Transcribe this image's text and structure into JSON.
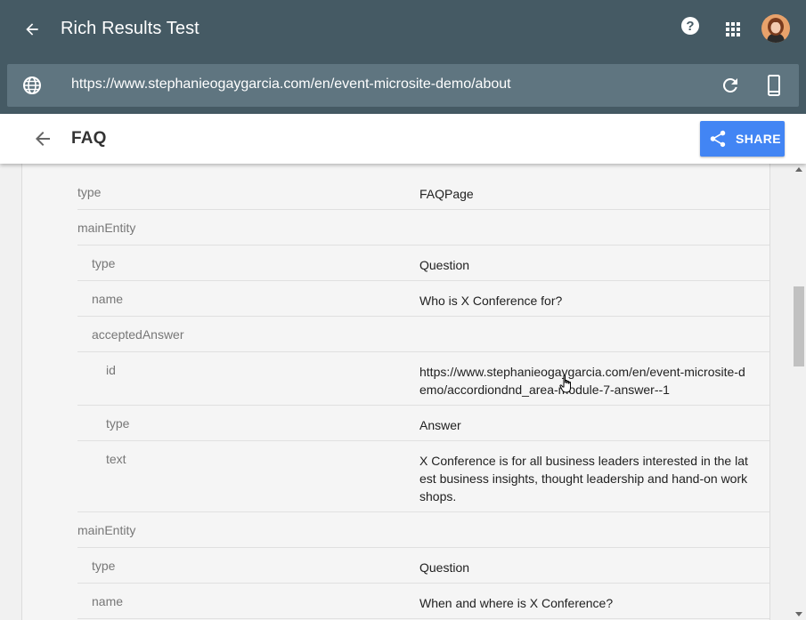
{
  "app": {
    "title": "Rich Results Test",
    "url": "https://www.stephanieogaygarcia.com/en/event-microsite-demo/about"
  },
  "subheader": {
    "title": "FAQ",
    "share_label": "SHARE"
  },
  "colors": {
    "appbar": "#455a64",
    "urlbar": "#5f7580",
    "share_button": "#4285f4"
  },
  "icons": {
    "back": "arrow-left-icon",
    "help": "help-icon",
    "apps": "apps-grid-icon",
    "globe": "globe-icon",
    "refresh": "refresh-icon",
    "device": "smartphone-icon",
    "share": "share-icon"
  },
  "rows": [
    {
      "key": "type",
      "value": "FAQPage"
    },
    {
      "key": "mainEntity",
      "value": ""
    },
    {
      "key": "type",
      "value": "Question"
    },
    {
      "key": "name",
      "value": "Who is X Conference for?"
    },
    {
      "key": "acceptedAnswer",
      "value": ""
    },
    {
      "key": "id",
      "value": "https://www.stephanieogaygarcia.com/en/event-microsite-demo/accordiondnd_area-module-7-answer--1"
    },
    {
      "key": "type",
      "value": "Answer"
    },
    {
      "key": "text",
      "value": "X Conference is for all business leaders interested in the latest business insights, thought leadership and hand-on workshops."
    },
    {
      "key": "mainEntity",
      "value": ""
    },
    {
      "key": "type",
      "value": "Question"
    },
    {
      "key": "name",
      "value": "When and where is X Conference?"
    }
  ]
}
